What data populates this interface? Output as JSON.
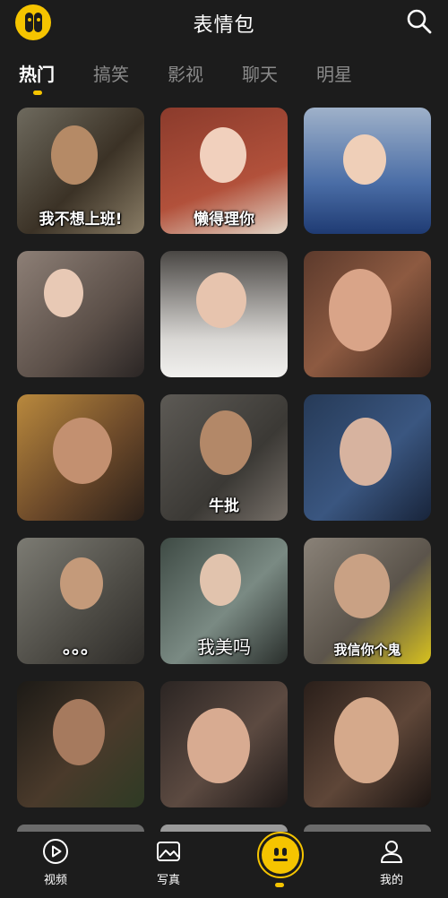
{
  "header": {
    "title": "表情包",
    "logo_icon": "app-logo-icon",
    "search_icon": "search-icon"
  },
  "tabs": [
    {
      "label": "热门",
      "active": true
    },
    {
      "label": "搞笑",
      "active": false
    },
    {
      "label": "影视",
      "active": false
    },
    {
      "label": "聊天",
      "active": false
    },
    {
      "label": "明星",
      "active": false
    }
  ],
  "grid": {
    "cards": [
      {
        "caption": "我不想上班!"
      },
      {
        "caption": "懒得理你"
      },
      {
        "caption": ""
      },
      {
        "caption": ""
      },
      {
        "caption": ""
      },
      {
        "caption": ""
      },
      {
        "caption": ""
      },
      {
        "caption": "牛批"
      },
      {
        "caption": ""
      },
      {
        "caption": "。。。"
      },
      {
        "caption": "我美吗"
      },
      {
        "caption": "我信你个鬼"
      },
      {
        "caption": ""
      },
      {
        "caption": ""
      },
      {
        "caption": ""
      }
    ]
  },
  "bottom_nav": {
    "items": [
      {
        "label": "视频",
        "icon": "play-icon"
      },
      {
        "label": "写真",
        "icon": "image-icon"
      },
      {
        "label": "",
        "icon": "emoji-face-icon"
      },
      {
        "label": "我的",
        "icon": "user-icon"
      }
    ]
  },
  "colors": {
    "background": "#1c1c1c",
    "accent": "#f5c400",
    "inactive_tab": "#8a8a8a"
  }
}
